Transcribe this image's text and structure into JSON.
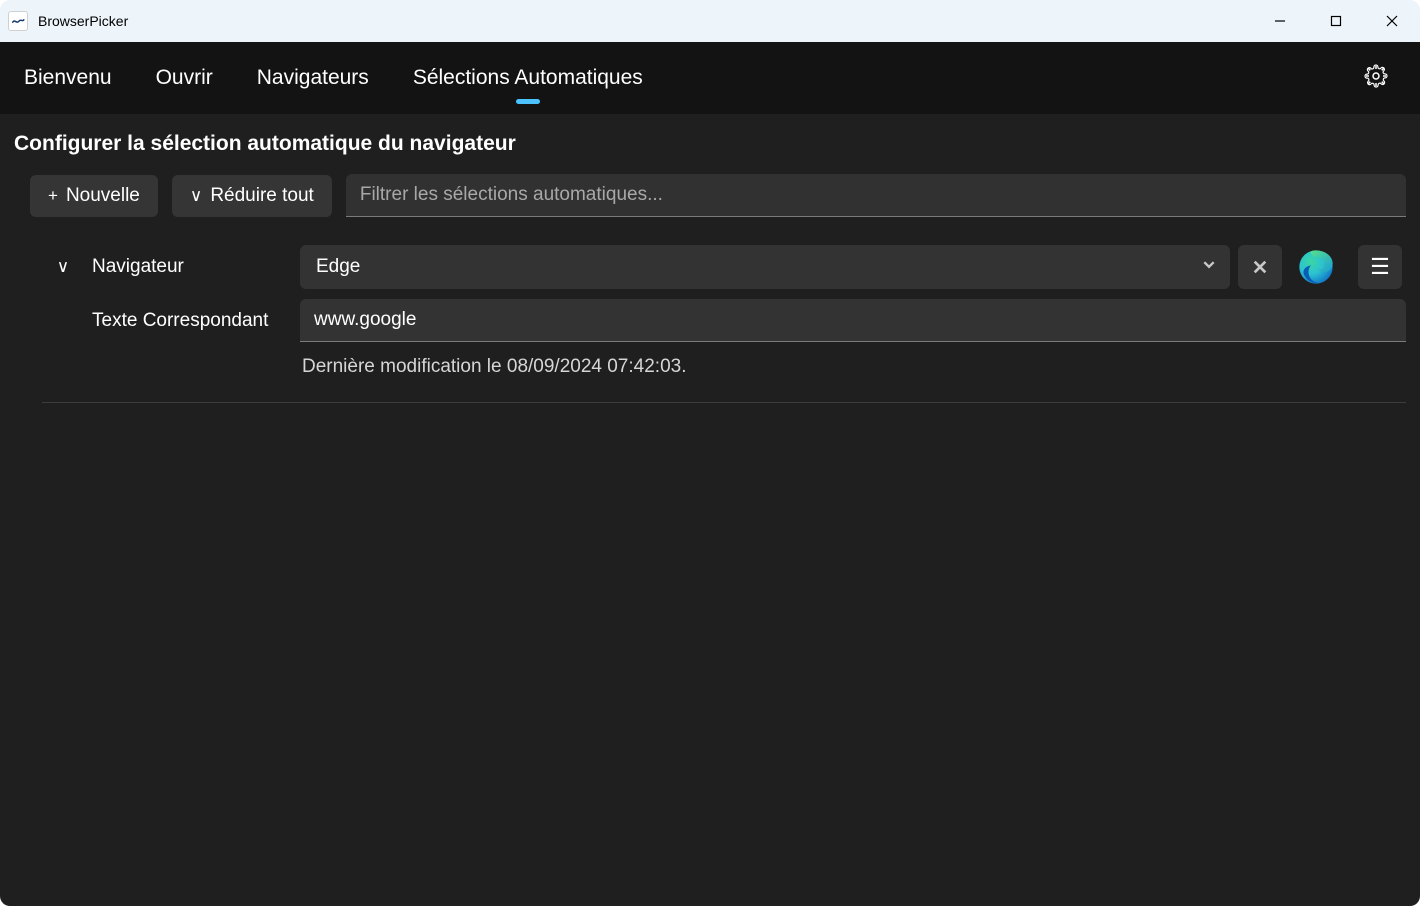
{
  "window": {
    "title": "BrowserPicker"
  },
  "tabs": {
    "items": [
      "Bienvenu",
      "Ouvrir",
      "Navigateurs",
      "Sélections Automatiques"
    ],
    "active_index": 3
  },
  "page": {
    "title": "Configurer la sélection automatique du navigateur"
  },
  "toolbar": {
    "new_label": "Nouvelle",
    "collapse_label": "Réduire tout",
    "filter_placeholder": "Filtrer les sélections automatiques..."
  },
  "labels": {
    "browser": "Navigateur",
    "matching_text": "Texte Correspondant"
  },
  "entry": {
    "browser_value": "Edge",
    "matching_text_value": "www.google",
    "last_modified": "Dernière modification le 08/09/2024 07:42:03."
  },
  "icons": {
    "expand": "∨",
    "plus": "+",
    "hamburger": "☰"
  }
}
